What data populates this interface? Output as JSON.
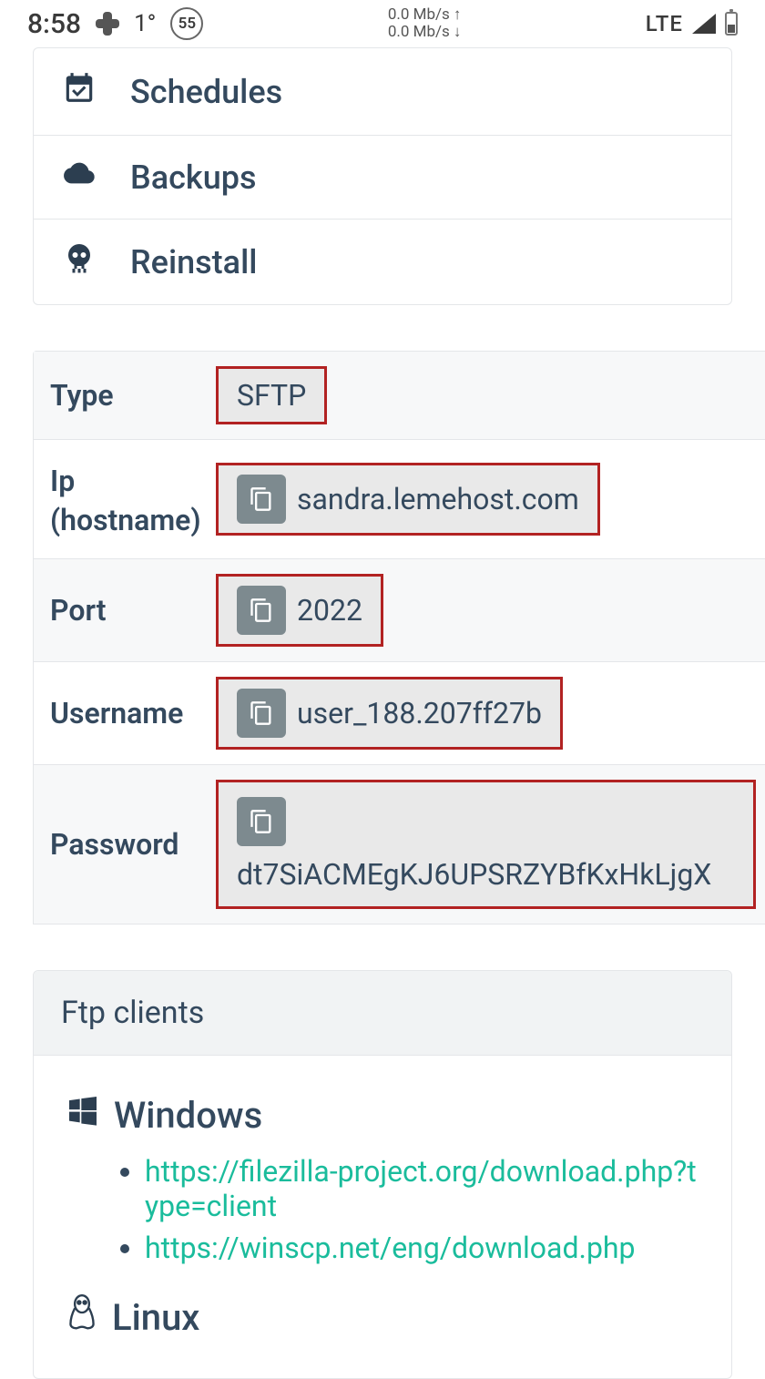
{
  "statusbar": {
    "time": "8:58",
    "temp": "1°",
    "badge": "55",
    "net_up": "0.0 Mb/s",
    "net_down": "0.0 Mb/s",
    "network": "LTE"
  },
  "menu": {
    "schedules": "Schedules",
    "backups": "Backups",
    "reinstall": "Reinstall"
  },
  "creds": {
    "type_label": "Type",
    "type_value": "SFTP",
    "ip_label": "Ip (hostname)",
    "ip_value": "sandra.lemehost.com",
    "port_label": "Port",
    "port_value": "2022",
    "username_label": "Username",
    "username_value": "user_188.207ff27b",
    "password_label": "Password",
    "password_value": "dt7SiACMEgKJ6UPSRZYBfKxHkLjgX"
  },
  "ftp_clients": {
    "header": "Ftp clients",
    "windows_label": "Windows",
    "windows_links": [
      "https://filezilla-project.org/download.php?type=client",
      "https://winscp.net/eng/download.php"
    ],
    "linux_label": "Linux"
  }
}
